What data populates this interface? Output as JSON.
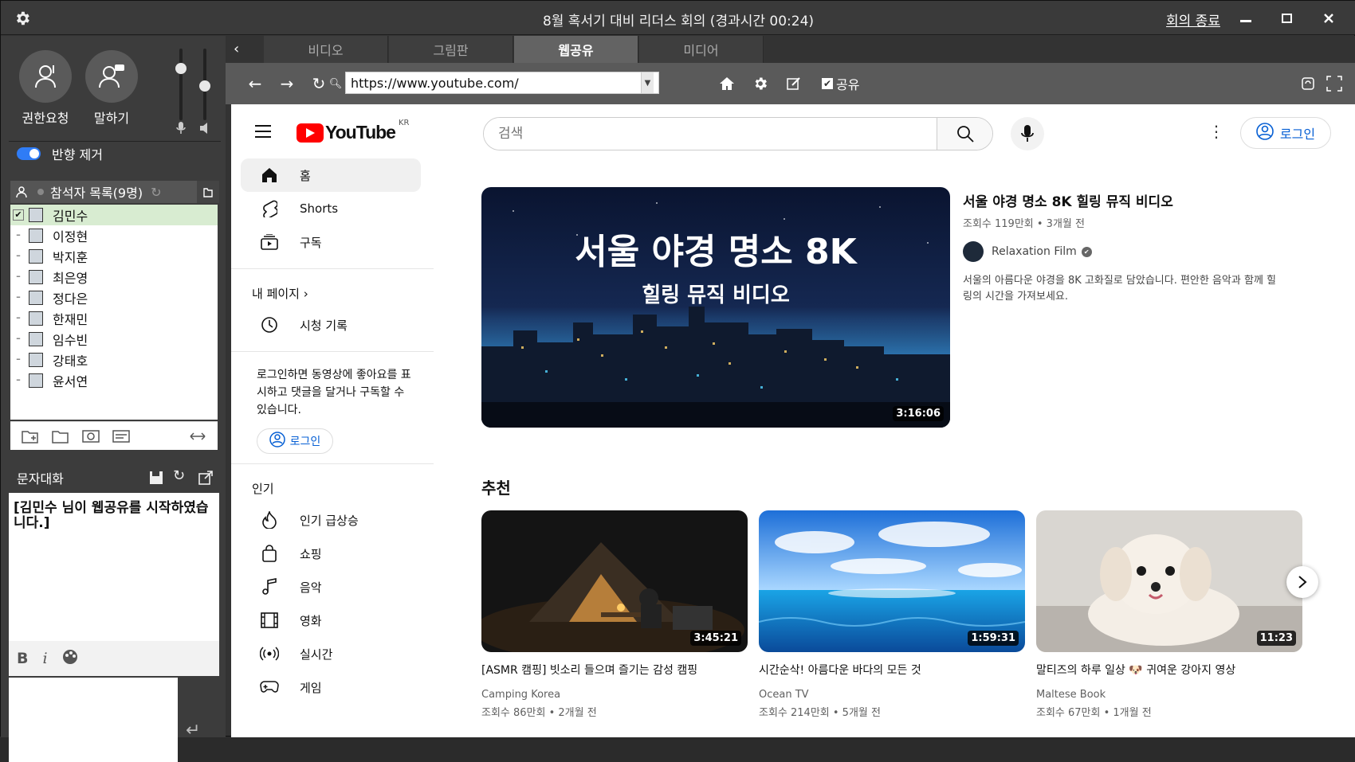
{
  "window": {
    "title": "8월 혹서기 대비 리더스 회의 (경과시간 00:24)",
    "end_meeting": "회의 종료"
  },
  "left": {
    "request_permission": "권한요청",
    "speak": "말하기",
    "echo_cancel": "반향 제거",
    "participants_header": "참석자 목록(9명)",
    "participants": [
      "김민수",
      "이정현",
      "박지훈",
      "최은영",
      "정다은",
      "한재민",
      "임수빈",
      "강태호",
      "윤서연"
    ],
    "chat_title": "문자대화",
    "chat_message": "[김민수 님이 웹공유를 시작하였습니다.]",
    "format": {
      "bold": "B",
      "italic": "i"
    }
  },
  "tabs": [
    "비디오",
    "그림판",
    "웹공유",
    "미디어"
  ],
  "active_tab": 2,
  "navbar": {
    "url": "https://www.youtube.com/",
    "share_label": "공유"
  },
  "youtube": {
    "logo_text": "YouTube",
    "region": "KR",
    "search_placeholder": "검색",
    "login": "로그인",
    "sidebar": {
      "main": [
        "홈",
        "Shorts",
        "구독"
      ],
      "my_page": "내 페이지",
      "history": "시청 기록",
      "login_note": "로그인하면 동영상에 좋아요를 표시하고 댓글을 달거나 구독할 수 있습니다.",
      "login_btn": "로그인",
      "popular": "인기",
      "explore": [
        "인기 급상승",
        "쇼핑",
        "음악",
        "영화",
        "실시간",
        "게임"
      ]
    },
    "hero": {
      "title": "서울 야경 명소 8K 힐링 뮤직 비디오",
      "overlay_line1": "서울 야경 명소 8K",
      "overlay_line2": "힐링 뮤직 비디오",
      "meta": "조회수 119만회 • 3개월 전",
      "channel": "Relaxation Film",
      "verified": "✔",
      "description": "서울의 아름다운 야경을 8K 고화질로 담았습니다. 편안한 음악과 함께 힐링의 시간을 가져보세요.",
      "duration": "3:16:06"
    },
    "recommended_title": "추천",
    "cards": [
      {
        "title": "[ASMR 캠핑] 빗소리 들으며 즐기는 감성 캠핑",
        "channel": "Camping Korea",
        "meta": "조회수 86만회 • 2개월 전",
        "duration": "3:45:21"
      },
      {
        "title": "시간순삭! 아름다운 바다의 모든 것",
        "channel": "Ocean TV",
        "meta": "조회수 214만회 • 5개월 전",
        "duration": "1:59:31"
      },
      {
        "title": "말티즈의 하루 일상 🐶 귀여운 강아지 영상",
        "channel": "Maltese Book",
        "meta": "조회수 67만회 • 1개월 전",
        "duration": "11:23"
      }
    ]
  },
  "colors": {
    "accent_blue": "#2f7cf6",
    "yt_red": "#ff0000",
    "link_blue": "#065fd4",
    "selected_row": "#d8ecd1"
  }
}
